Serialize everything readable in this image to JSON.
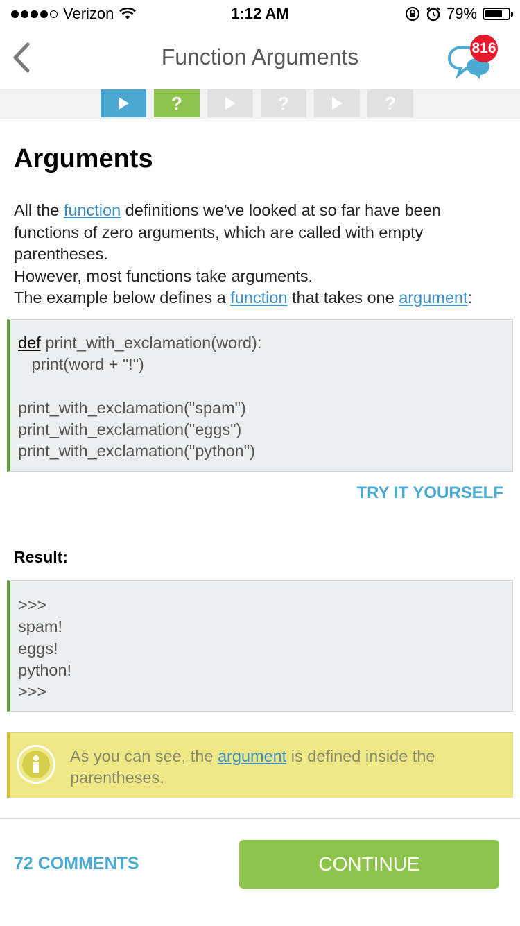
{
  "status_bar": {
    "carrier": "Verizon",
    "time": "1:12 AM",
    "battery_percent": "79%",
    "battery_level": 0.79
  },
  "nav": {
    "title": "Function Arguments",
    "notification_count": "816"
  },
  "progress": {
    "steps": [
      {
        "type": "play",
        "state": "current"
      },
      {
        "type": "quiz",
        "label": "?",
        "state": "done"
      },
      {
        "type": "play",
        "state": "locked"
      },
      {
        "type": "quiz",
        "label": "?",
        "state": "locked"
      },
      {
        "type": "play",
        "state": "locked"
      },
      {
        "type": "quiz",
        "label": "?",
        "state": "locked"
      }
    ]
  },
  "lesson": {
    "heading": "Arguments",
    "p1_a": "All the ",
    "p1_link": "function",
    "p1_b": " definitions we've looked at so far have been functions of zero arguments, which are called with empty parentheses.",
    "p2": "However, most functions take arguments.",
    "p3_a": "The example below defines a ",
    "p3_link1": "function",
    "p3_b": " that takes one ",
    "p3_link2": "argument",
    "p3_c": ":"
  },
  "code": {
    "keyword": "def",
    "line1_rest": " print_with_exclamation(word):",
    "line2": "   print(word + \"!\")",
    "line3": "",
    "line4": "print_with_exclamation(\"spam\")",
    "line5": "print_with_exclamation(\"eggs\")",
    "line6": "print_with_exclamation(\"python\")"
  },
  "try_label": "TRY IT YOURSELF",
  "result": {
    "label": "Result:",
    "lines": [
      ">>>",
      "spam!",
      "eggs!",
      "python!",
      ">>>"
    ]
  },
  "info": {
    "text_a": "As you can see, the ",
    "link": "argument",
    "text_b": " is defined inside the parentheses."
  },
  "footer": {
    "comments_label": "72 COMMENTS",
    "continue_label": "CONTINUE"
  },
  "colors": {
    "accent_blue": "#4aa8d4",
    "accent_green": "#8cc34a",
    "badge_red": "#e8192c",
    "info_yellow": "#eee886"
  }
}
